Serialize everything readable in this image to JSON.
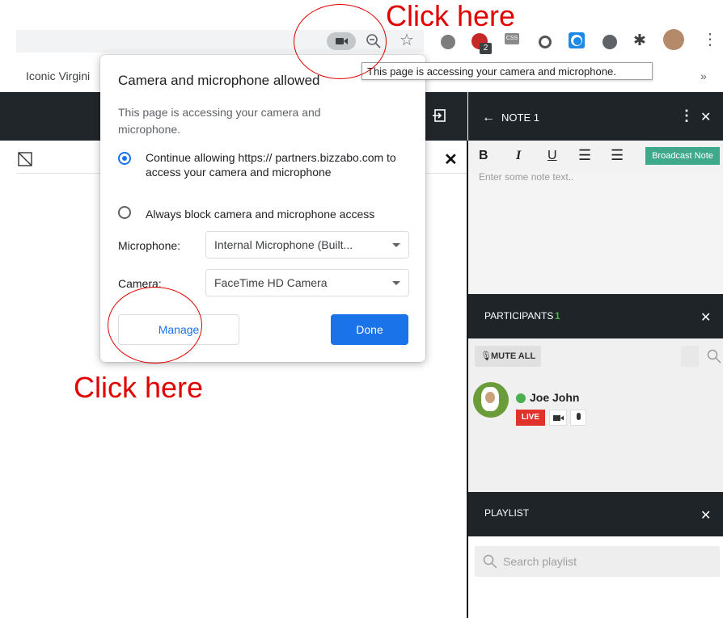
{
  "browser": {
    "bookmark_text": "Iconic Virgini",
    "bookmarks_more": "»",
    "tooltip": "This page is accessing your camera and microphone.",
    "badge_count": "2",
    "css_ext": "CSS"
  },
  "popup": {
    "title": "Camera and microphone allowed",
    "description": "This page is accessing your camera and microphone.",
    "options": [
      {
        "label": "Continue allowing https:// partners.bizzabo.com to access your camera and microphone",
        "selected": true
      },
      {
        "label": "Always block camera and microphone access",
        "selected": false
      }
    ],
    "microphone_label": "Microphone:",
    "microphone_value": "Internal Microphone (Built...",
    "camera_label": "Camera:",
    "camera_value": "FaceTime HD Camera",
    "manage_label": "Manage",
    "done_label": "Done"
  },
  "sidebar": {
    "note_title": "NOTE 1",
    "note_placeholder": "Enter some note text..",
    "broadcast_label": "Broadcast Note",
    "format_buttons": [
      "B",
      "I",
      "U"
    ],
    "participants_title": "PARTICIPANTS",
    "participants_count": "1",
    "mute_all_label": "MUTE ALL",
    "participant_name": "Joe John",
    "live_badge": "LIVE",
    "playlist_title": "PLAYLIST",
    "playlist_search_placeholder": "Search playlist"
  },
  "annotations": {
    "top": "Click here",
    "bottom": "Click here"
  },
  "colors": {
    "accent_blue": "#1a73e8",
    "annotation_red": "#e00000",
    "sidebar_header": "#1f2429",
    "broadcast_green": "#3fa98c",
    "live_red": "#e0322b"
  },
  "icons": {
    "camera": "camera-icon",
    "zoom": "zoom-out-icon",
    "star": "bookmark-star-icon",
    "extensions": "puzzle-icon",
    "menu": "kebab-menu-icon"
  }
}
